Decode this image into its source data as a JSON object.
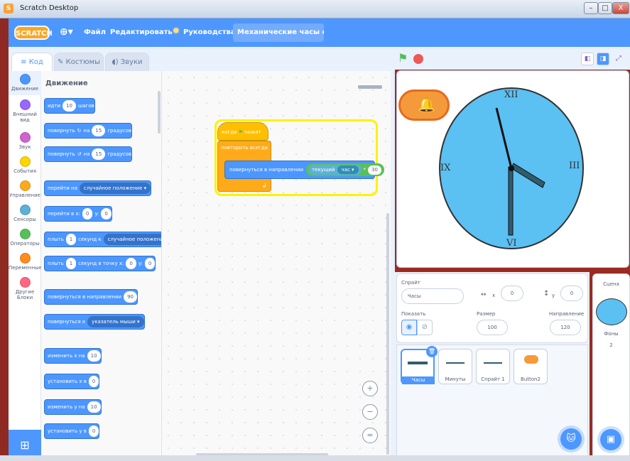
{
  "window": {
    "title": "Scratch Desktop",
    "min": "–",
    "max": "□",
    "close": "X"
  },
  "menu": {
    "logo": "SCRATCH",
    "file": "Файл",
    "edit": "Редактировать",
    "tutorials": "Руководства",
    "project": "Механические часы с бу..."
  },
  "tabs": [
    {
      "label": "Код"
    },
    {
      "label": "Костюмы"
    },
    {
      "label": "Звуки"
    }
  ],
  "categories": [
    {
      "label": "Движение",
      "color": "#4c97ff"
    },
    {
      "label": "Внешний вид",
      "color": "#9966ff"
    },
    {
      "label": "Звук",
      "color": "#cf63cf"
    },
    {
      "label": "События",
      "color": "#ffd500"
    },
    {
      "label": "Управление",
      "color": "#ffab19"
    },
    {
      "label": "Сенсоры",
      "color": "#5cb1d6"
    },
    {
      "label": "Операторы",
      "color": "#59c059"
    },
    {
      "label": "Переменные",
      "color": "#ff8c1a"
    },
    {
      "label": "Другие Блоки",
      "color": "#ff6680"
    }
  ],
  "palette": {
    "heading": "Движение",
    "b1": {
      "t1": "идти",
      "v": "10",
      "t2": "шагов"
    },
    "b2": {
      "t1": "повернуть",
      "t2": "на",
      "v": "15",
      "t3": "градусов"
    },
    "b3": {
      "t1": "повернуть",
      "t2": "на",
      "v": "15",
      "t3": "градусов"
    },
    "b4": {
      "t1": "перейти на",
      "d": "случайное положение"
    },
    "b5": {
      "t1": "перейти в x:",
      "x": "0",
      "t2": "y:",
      "y": "0"
    },
    "b6": {
      "t1": "плыть",
      "v": "1",
      "t2": "секунд к",
      "d": "случайное положение"
    },
    "b7": {
      "t1": "плыть",
      "v": "1",
      "t2": "секунд в точку x:",
      "x": "0",
      "t3": "y:",
      "y": "0"
    },
    "b8": {
      "t1": "повернуться в направлении",
      "v": "90"
    },
    "b9": {
      "t1": "повернуться к",
      "d": "указатель мыши"
    },
    "b10": {
      "t1": "изменить х на",
      "v": "10"
    },
    "b11": {
      "t1": "установить х в",
      "v": "0"
    },
    "b12": {
      "t1": "изменить у на",
      "v": "10"
    },
    "b13": {
      "t1": "установить у в",
      "v": "0"
    }
  },
  "script": {
    "hat": "когда",
    "hat2": "нажат",
    "forever": "повторить всегда",
    "point": "повернуться в направлении",
    "sensor": "текущий",
    "sensor_opt": "час",
    "op": "*",
    "op_val": "30"
  },
  "zoom": {
    "in": "+",
    "out": "−",
    "reset": "="
  },
  "clock": {
    "n12": "XII",
    "n3": "III",
    "n6": "VI",
    "n9": "IX",
    "face_color": "#5bc0f2"
  },
  "sprite": {
    "label": "Спрайт",
    "name": "Часы",
    "x_label": "x",
    "x": "0",
    "y_label": "y",
    "y": "0",
    "show": "Показать",
    "size_label": "Размер",
    "size": "100",
    "dir_label": "Направление",
    "dir": "120"
  },
  "sprites": [
    {
      "name": "Часы"
    },
    {
      "name": "Минуты"
    },
    {
      "name": "Спрайт 1"
    },
    {
      "name": "Button2"
    }
  ],
  "scene": {
    "label": "Сцена",
    "backdrops_label": "Фоны",
    "backdrops": "2"
  }
}
